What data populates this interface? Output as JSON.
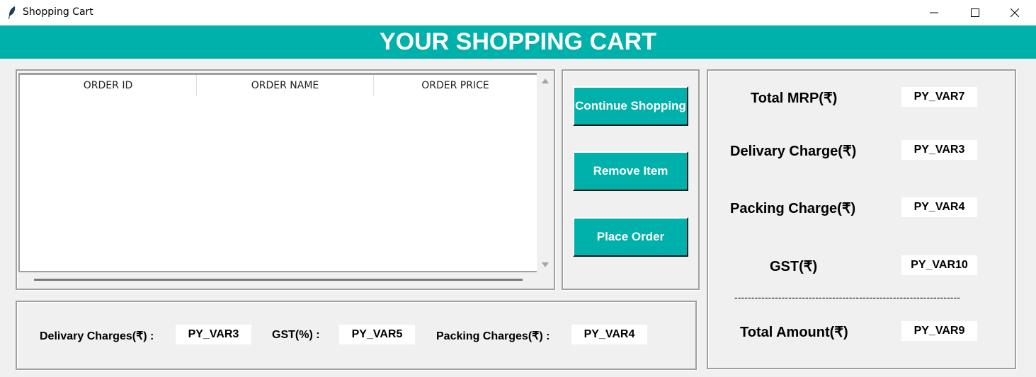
{
  "window": {
    "title": "Shopping Cart",
    "controls": {
      "minimize": "—",
      "maximize": "☐",
      "close": "✕"
    }
  },
  "banner": {
    "title": "YOUR SHOPPING CART"
  },
  "table": {
    "columns": [
      "ORDER ID",
      "ORDER NAME",
      "ORDER PRICE"
    ],
    "rows": []
  },
  "actions": {
    "continue": "Continue Shopping",
    "remove": "Remove Item",
    "place": "Place Order"
  },
  "summary": {
    "total_mrp_label": "Total MRP(₹)",
    "total_mrp_value": "PY_VAR7",
    "delivery_label": "Delivary Charge(₹)",
    "delivery_value": "PY_VAR3",
    "packing_label": "Packing Charge(₹)",
    "packing_value": "PY_VAR4",
    "gst_label": "GST(₹)",
    "gst_value": "PY_VAR10",
    "separator": "-------------------------------------------------------------------",
    "total_amount_label": "Total Amount(₹)",
    "total_amount_value": "PY_VAR9"
  },
  "charges": {
    "delivery_label": "Delivary Charges(₹) :",
    "delivery_value": "PY_VAR3",
    "gst_label": "GST(%) :",
    "gst_value": "PY_VAR5",
    "packing_label": "Packing Charges(₹) :",
    "packing_value": "PY_VAR4"
  },
  "colors": {
    "accent": "#00b0aa",
    "background": "#f0f0f0"
  }
}
